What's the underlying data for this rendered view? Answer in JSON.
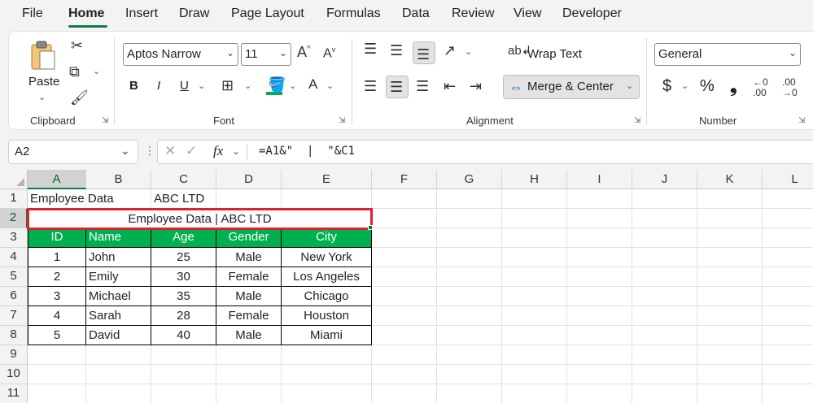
{
  "menu": {
    "items": [
      "File",
      "Home",
      "Insert",
      "Draw",
      "Page Layout",
      "Formulas",
      "Data",
      "Review",
      "View",
      "Developer"
    ],
    "active": "Home"
  },
  "ribbon": {
    "clipboard": {
      "paste_label": "Paste",
      "group_label": "Clipboard"
    },
    "font": {
      "font_name": "Aptos Narrow",
      "font_size": "11",
      "group_label": "Font",
      "bold": "B",
      "italic": "I",
      "underline": "U"
    },
    "alignment": {
      "wrap_text": "Wrap Text",
      "merge_center": "Merge & Center",
      "group_label": "Alignment"
    },
    "number": {
      "format": "General",
      "currency": "$",
      "percent": "%",
      "comma": ")",
      "group_label": "Number"
    }
  },
  "formula_bar": {
    "name_box": "A2",
    "fx_label": "fx",
    "formula": "=A1&\"  |  \"&C1"
  },
  "sheet": {
    "columns": [
      "A",
      "B",
      "C",
      "D",
      "E",
      "F",
      "G",
      "H",
      "I",
      "J",
      "K",
      "L"
    ],
    "selected_column": "A",
    "rows": [
      "1",
      "2",
      "3",
      "4",
      "5",
      "6",
      "7",
      "8",
      "9",
      "10",
      "11"
    ],
    "selected_row": "2",
    "row1": {
      "a1": "Employee Data",
      "c1": "ABC LTD"
    },
    "merged_a2": "Employee Data | ABC LTD",
    "table_headers": [
      "ID",
      "Name",
      "Age",
      "Gender",
      "City"
    ],
    "table_rows": [
      [
        "1",
        "John",
        "25",
        "Male",
        "New York"
      ],
      [
        "2",
        "Emily",
        "30",
        "Female",
        "Los Angeles"
      ],
      [
        "3",
        "Michael",
        "35",
        "Male",
        "Chicago"
      ],
      [
        "4",
        "Sarah",
        "28",
        "Female",
        "Houston"
      ],
      [
        "5",
        "David",
        "40",
        "Male",
        "Miami"
      ]
    ],
    "header_fill": "#00b050",
    "highlight_color": "#e0202e"
  }
}
